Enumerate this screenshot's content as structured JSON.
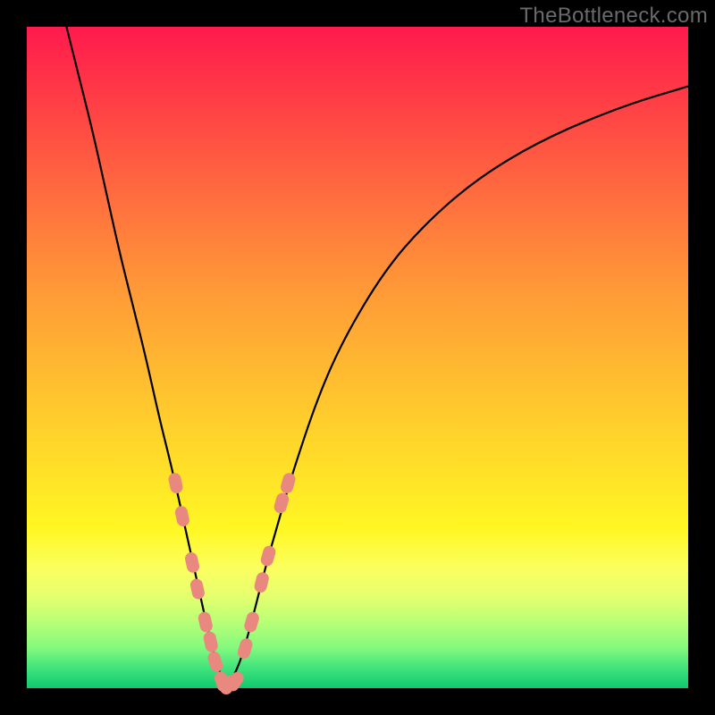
{
  "watermark": "TheBottleneck.com",
  "colors": {
    "curve": "#000000",
    "marker_fill": "#e9887e",
    "marker_stroke": "#e9887e",
    "frame": "#000000"
  },
  "chart_data": {
    "type": "line",
    "title": "",
    "xlabel": "",
    "ylabel": "",
    "xlim": [
      0,
      100
    ],
    "ylim": [
      0,
      100
    ],
    "grid": false,
    "legend": false,
    "series": [
      {
        "name": "bottleneck-curve",
        "comment": "Approximate percentage bottleneck (y) as a function of relative component score (x). Two branches meeting near x≈30 at y≈0. Values estimated from pixel positions.",
        "x": [
          6,
          8,
          10,
          12,
          14,
          16,
          18,
          20,
          22,
          24,
          26,
          28,
          30,
          32,
          34,
          36,
          38,
          40,
          44,
          48,
          54,
          60,
          68,
          78,
          90,
          100
        ],
        "values": [
          100,
          92,
          84,
          75,
          66,
          58,
          50,
          41,
          33,
          24,
          15,
          6,
          0,
          3,
          10,
          18,
          25,
          32,
          44,
          53,
          63,
          70,
          77,
          83,
          88,
          91
        ]
      }
    ],
    "markers": {
      "comment": "Salmon capsule-shaped markers highlighting specific sample points along the curve near its minimum.",
      "points": [
        {
          "x": 22.5,
          "y": 31
        },
        {
          "x": 23.5,
          "y": 26
        },
        {
          "x": 25.0,
          "y": 19
        },
        {
          "x": 25.8,
          "y": 15
        },
        {
          "x": 27.0,
          "y": 10
        },
        {
          "x": 27.8,
          "y": 7
        },
        {
          "x": 28.5,
          "y": 4
        },
        {
          "x": 29.5,
          "y": 1
        },
        {
          "x": 30.5,
          "y": 0.5
        },
        {
          "x": 31.5,
          "y": 1
        },
        {
          "x": 33.0,
          "y": 6
        },
        {
          "x": 34.0,
          "y": 10
        },
        {
          "x": 35.5,
          "y": 16
        },
        {
          "x": 36.5,
          "y": 20
        },
        {
          "x": 38.5,
          "y": 28
        },
        {
          "x": 39.5,
          "y": 31
        }
      ]
    }
  }
}
